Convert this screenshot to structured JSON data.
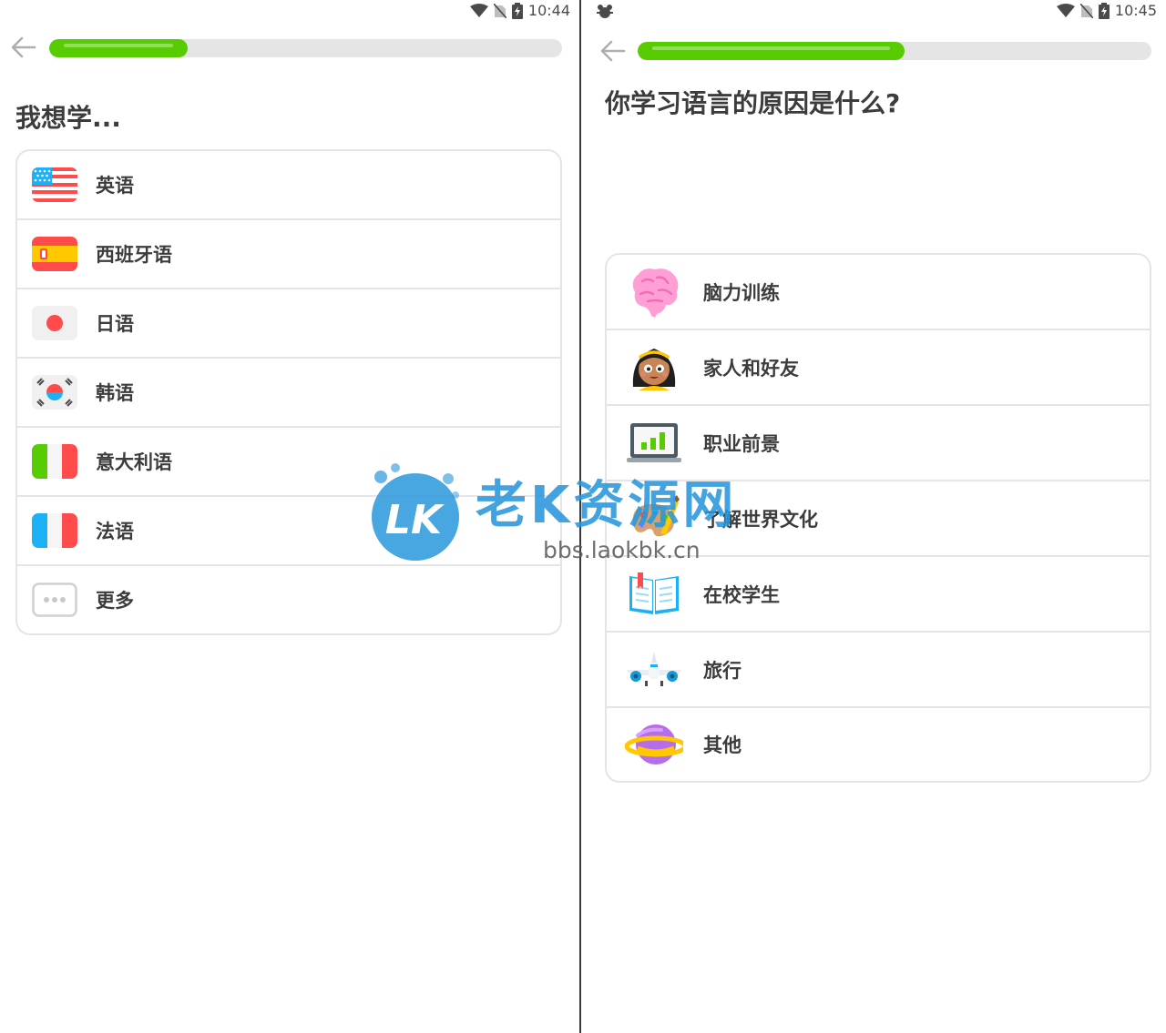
{
  "left_screen": {
    "status_bar": {
      "time": "10:44"
    },
    "progress": 0.27,
    "heading": "我想学...",
    "languages": [
      {
        "label": "英语",
        "flag": "us-flag"
      },
      {
        "label": "西班牙语",
        "flag": "spain-flag"
      },
      {
        "label": "日语",
        "flag": "japan-flag"
      },
      {
        "label": "韩语",
        "flag": "korea-flag"
      },
      {
        "label": "意大利语",
        "flag": "italy-flag"
      },
      {
        "label": "法语",
        "flag": "france-flag"
      },
      {
        "label": "更多",
        "flag": "more-icon"
      }
    ]
  },
  "right_screen": {
    "status_bar": {
      "time": "10:45"
    },
    "progress": 0.52,
    "heading": "你学习语言的原因是什么?",
    "reasons": [
      {
        "label": "脑力训练",
        "icon": "brain-icon"
      },
      {
        "label": "家人和好友",
        "icon": "person-icon"
      },
      {
        "label": "职业前景",
        "icon": "chart-monitor-icon"
      },
      {
        "label": "了解世界文化",
        "icon": "palette-icon"
      },
      {
        "label": "在校学生",
        "icon": "book-icon"
      },
      {
        "label": "旅行",
        "icon": "airplane-icon"
      },
      {
        "label": "其他",
        "icon": "planet-icon"
      }
    ]
  },
  "watermark": {
    "title": "老K资源网",
    "url": "bbs.laokbk.cn",
    "logo_text": "LK"
  },
  "colors": {
    "accent_green": "#58cc02",
    "track_gray": "#e5e5e5",
    "border_gray": "#e5e5e5",
    "text_dark": "#3c3c3c"
  }
}
